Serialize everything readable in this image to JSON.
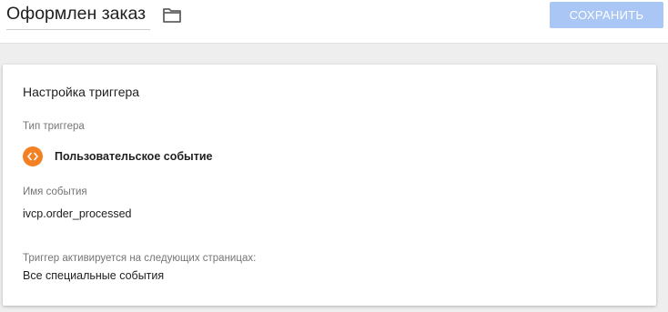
{
  "header": {
    "title": "Оформлен заказ",
    "save_label": "СОХРАНИТЬ",
    "folder_icon": "folder-icon"
  },
  "card": {
    "title": "Настройка триггера",
    "trigger_type_label": "Тип триггера",
    "trigger_type_value": "Пользовательское событие",
    "trigger_type_icon": "custom-event-icon",
    "event_name_label": "Имя события",
    "event_name_value": "ivcp.order_processed",
    "fires_on_label": "Триггер активируется на следующих страницах:",
    "fires_on_value": "Все специальные события"
  },
  "colors": {
    "save_button": "#a9c6f4",
    "event_icon": "#f48024",
    "background": "#eeeeee"
  }
}
